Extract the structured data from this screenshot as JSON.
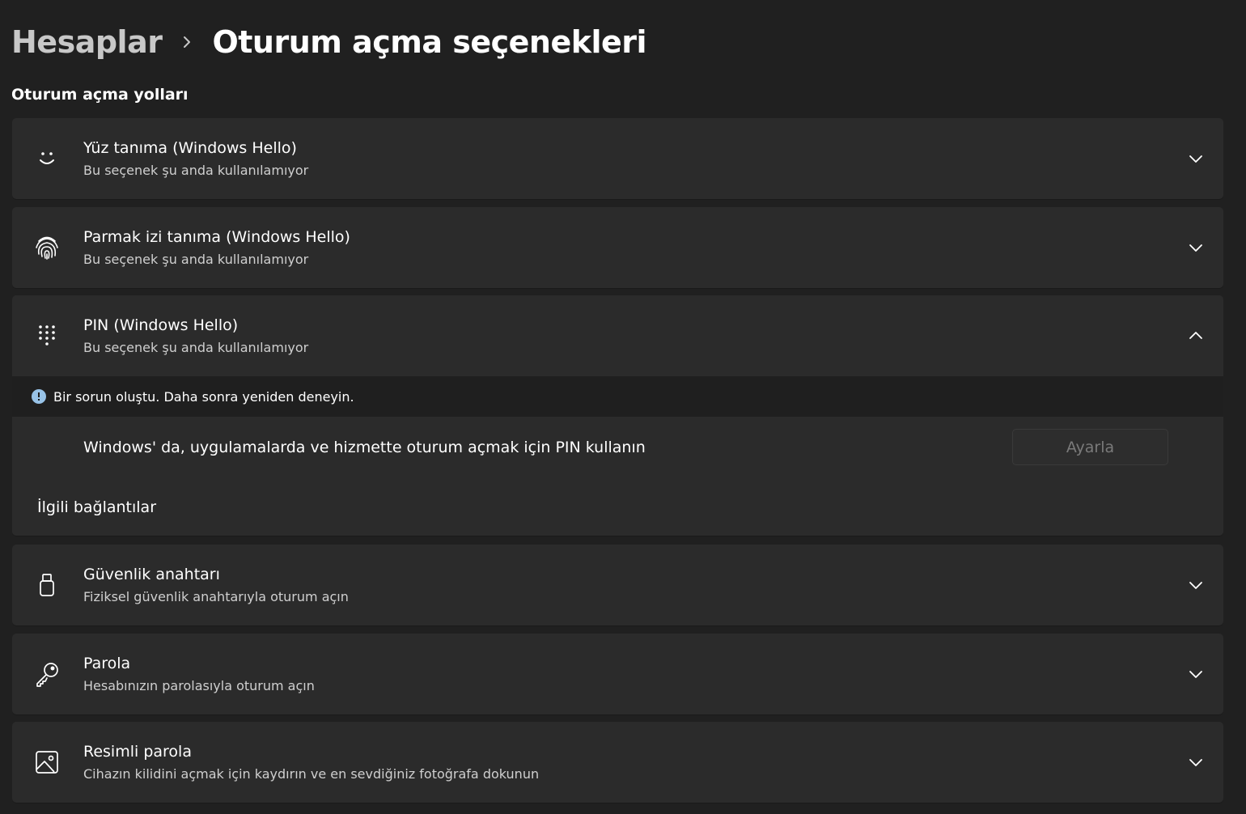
{
  "breadcrumb": {
    "parent": "Hesaplar",
    "current": "Oturum açma seçenekleri"
  },
  "section_title": "Oturum açma yolları",
  "options": [
    {
      "icon": "face-icon",
      "title": "Yüz tanıma (Windows Hello)",
      "subtitle": "Bu seçenek şu anda kullanılamıyor",
      "expanded": false
    },
    {
      "icon": "fingerprint-icon",
      "title": "Parmak izi tanıma (Windows Hello)",
      "subtitle": "Bu seçenek şu anda kullanılamıyor",
      "expanded": false
    },
    {
      "icon": "pin-keypad-icon",
      "title": "PIN (Windows Hello)",
      "subtitle": "Bu seçenek şu anda kullanılamıyor",
      "expanded": true
    },
    {
      "icon": "security-key-icon",
      "title": "Güvenlik anahtarı",
      "subtitle": "Fiziksel güvenlik anahtarıyla oturum açın",
      "expanded": false
    },
    {
      "icon": "key-icon",
      "title": "Parola",
      "subtitle": "Hesabınızın parolasıyla oturum açın",
      "expanded": false
    },
    {
      "icon": "picture-icon",
      "title": "Resimli parola",
      "subtitle": "Cihazın kilidini açmak için kaydırın ve en sevdiğiniz fotoğrafa dokunun",
      "expanded": false
    }
  ],
  "pin_panel": {
    "info_message": "Bir sorun oluştu. Daha sonra yeniden deneyin.",
    "setting_text": "Windows' da, uygulamalarda ve hizmette oturum açmak için PIN kullanın",
    "setup_button": "Ayarla",
    "setup_button_enabled": false,
    "related_links": "İlgili bağlantılar"
  },
  "colors": {
    "background": "#202020",
    "card": "#2b2b2b",
    "info_icon": "#98c3e8",
    "disabled_text": "#7a7a7a"
  }
}
